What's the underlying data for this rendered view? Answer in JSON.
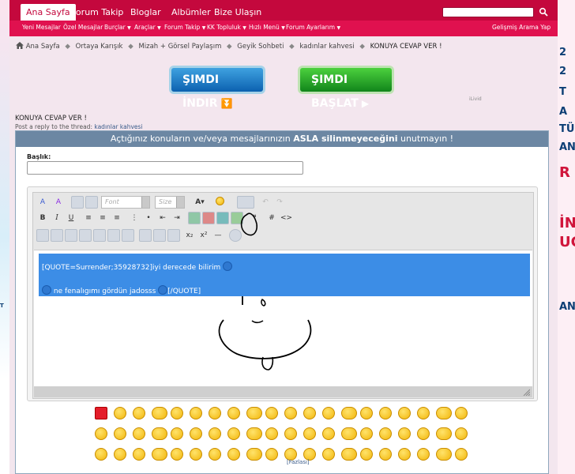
{
  "nav": {
    "tabs": [
      "Ana Sayfa",
      "Forum Takip",
      "Bloglar",
      "Albümler",
      "Bize Ulaşın"
    ],
    "active_tab": "Ana Sayfa"
  },
  "subnav": {
    "items": [
      "Yeni Mesajlar",
      "Özel Mesajlar",
      "Burçlar",
      "Araçlar",
      "Forum Takip",
      "KK Topluluk",
      "Hızlı Menü",
      "Forum Ayarlarım"
    ],
    "advanced_search": "Gelişmiş Arama Yap"
  },
  "breadcrumb": [
    "Ana Sayfa",
    "Ortaya Karışık",
    "Mizah + Görsel Paylaşım",
    "Geyik Sohbeti",
    "kadınlar kahvesi",
    "KONUYA CEVAP VER !"
  ],
  "ads": {
    "download": "ŞIMDI İNDIR",
    "start": "ŞIMDI BAŞLAT",
    "brand": "iLivid"
  },
  "page": {
    "title": "KONUYA CEVAP VER !",
    "subtitle_prefix": "Post a reply to the thread:",
    "thread_link": "kadınlar kahvesi"
  },
  "notice": {
    "before": "Açtığınız konuların ve/veya mesajlarınızın",
    "bold": "ASLA silinmeyeceğini",
    "after": "unutmayın !"
  },
  "form": {
    "title_label": "Başlık:",
    "title_value": ""
  },
  "editor": {
    "font_placeholder": "Font",
    "size_placeholder": "Size",
    "line1": "[QUOTE=Surrender;35928732]iyi derecede bilirim",
    "line2": "ne fenalıgımı gördün jadosss",
    "line2_end": "[/QUOTE]"
  },
  "smilies": {
    "more_label": "[Fazlası]"
  },
  "side_ads": {
    "right_text": [
      "2",
      "2",
      "T",
      "A",
      "TÜ",
      "ANA",
      "R",
      "İN",
      "UÇ",
      "ANA"
    ],
    "left_text": "T"
  },
  "colors": {
    "nav_primary": "#c4083d",
    "nav_secondary": "#e0114f",
    "panel_header": "#6c87a3",
    "selection": "#3c8de6"
  }
}
